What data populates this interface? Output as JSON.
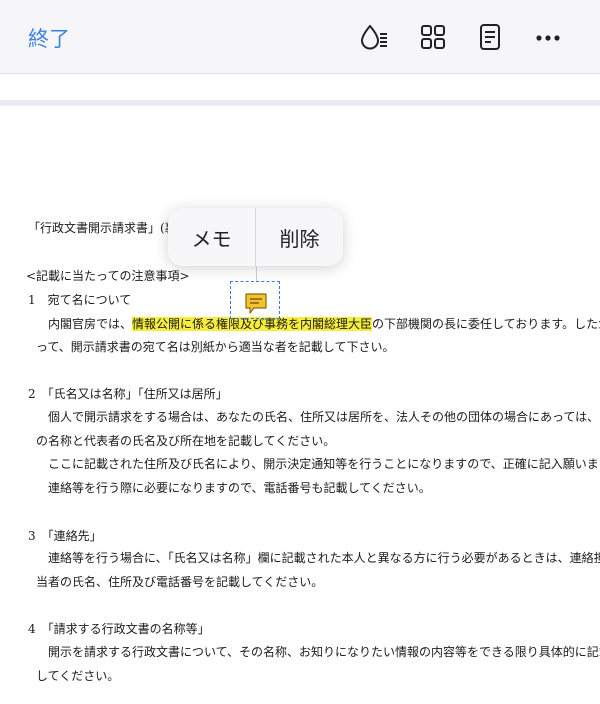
{
  "toolbar": {
    "done_label": "終了",
    "icons": [
      "ink-drop-icon",
      "grid-icon",
      "page-icon",
      "more-icon"
    ]
  },
  "popup": {
    "memo_label": "メモ",
    "delete_label": "削除"
  },
  "document": {
    "l01": "「行政文書開示請求書」(裏",
    "l02": "<記載に当たっての注意事項>",
    "l03": "1　宛て名について",
    "l04a": "内閣官房では、",
    "l04b": "情報公開に係る権限及び事務を内閣総理大臣",
    "l04c": "の下部機関の長に委任しております。したが",
    "l05": "って、開示請求書の宛て名は別紙から適当な者を記載して下さい。",
    "l06": "2　「氏名又は名称」「住所又は居所」",
    "l07": "個人で開示請求をする場合は、あなたの氏名、住所又は居所を、法人その他の団体の場合にあっては、そ",
    "l08": "の名称と代表者の氏名及び所在地を記載してください。",
    "l09": "ここに記載された住所及び氏名により、開示決定通知等を行うことになりますので、正確に記入願います。",
    "l10": "連絡等を行う際に必要になりますので、電話番号も記載してください。",
    "l11": "3　「連絡先」",
    "l12": "連絡等を行う場合に、「氏名又は名称」欄に記載された本人と異なる方に行う必要があるときは、連絡担",
    "l13": "当者の氏名、住所及び電話番号を記載してください。",
    "l14": "4　「請求する行政文書の名称等」",
    "l15": "開示を請求する行政文書について、その名称、お知りになりたい情報の内容等をできる限り具体的に記載",
    "l16": "してください。"
  },
  "colors": {
    "accent": "#3c82e6",
    "highlight": "#f6ee3a",
    "note": "#f2c230"
  }
}
